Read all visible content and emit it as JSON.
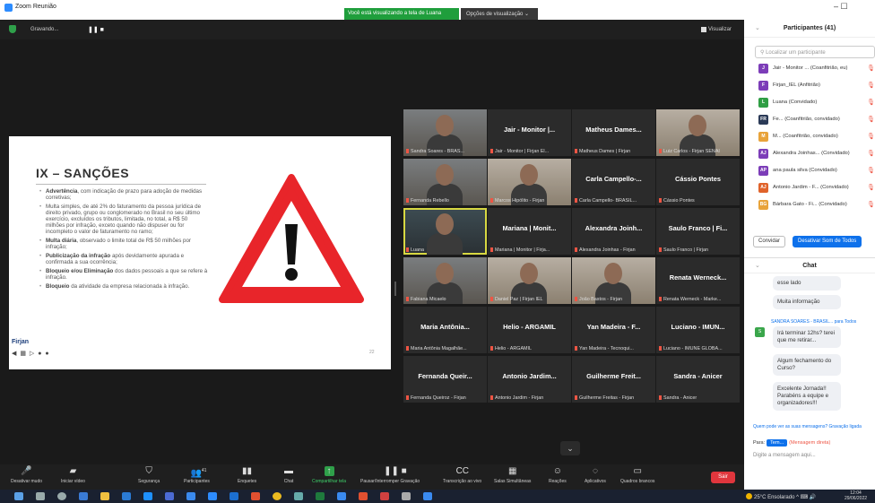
{
  "window": {
    "title": "Zoom Reunião",
    "controls": "– ☐"
  },
  "banner": {
    "sharing": "Você está visualizando a tela de Luana",
    "view_options": "Opções de visualização ⌄"
  },
  "meeting": {
    "status": "Gravando...",
    "pause": "❚❚ ■",
    "view_label": "Visualizar"
  },
  "slide": {
    "title": "IX – SANÇÕES",
    "items": [
      {
        "key": "Advertência",
        "text": ", com indicação de prazo para adoção de medidas corretivas;"
      },
      {
        "key": "",
        "text": "Multa simples, de até 2% do faturamento da pessoa jurídica de direito privado, grupo ou conglomerado no Brasil no seu último exercício, excluídos os tributos, limitada, no total, a R$ 50 milhões por infração, exceto quando não dispuser ou for incompleto o valor de faturamento no ramo;"
      },
      {
        "key": "Multa diária",
        "text": ", observado o limite total de R$ 50 milhões por infração;"
      },
      {
        "key": "Publicização da infração",
        "text": " após devidamente apurada e confirmada a sua ocorrência;"
      },
      {
        "key": "Bloqueio e/ou Eliminação",
        "text": " dos dados pessoais a que se refere à infração."
      },
      {
        "key": "Bloqueio",
        "text": " da atividade da empresa relacionada à infração."
      }
    ],
    "logo": "Firjan",
    "controls": "◀ ▦ ▷ ● ●",
    "page": "22"
  },
  "tiles": [
    {
      "name": "",
      "caption": "Sandra Soares - BRAS...",
      "style": "photo"
    },
    {
      "name": "Jair - Monitor |...",
      "caption": "Jair - Monitor | Firjan El...",
      "style": ""
    },
    {
      "name": "Matheus Dames...",
      "caption": "Matheus Dames | Firjan",
      "style": ""
    },
    {
      "name": "",
      "caption": "Luiz Carlos - Firjan SENAI",
      "style": "photo l"
    },
    {
      "name": "",
      "caption": "Fernanda Rebello",
      "style": "photo"
    },
    {
      "name": "",
      "caption": "Marcos Hipólito - Firjan",
      "style": "photo l"
    },
    {
      "name": "Carla Campello-...",
      "caption": "Carla Campello- BRASIL...",
      "style": ""
    },
    {
      "name": "Cássio Pontes",
      "caption": "Cássio Pontes",
      "style": ""
    },
    {
      "name": "",
      "caption": "Luana",
      "style": "photo d active"
    },
    {
      "name": "Mariana | Monit...",
      "caption": "Mariana | Monitor | Firja...",
      "style": ""
    },
    {
      "name": "Alexandra Joinh...",
      "caption": "Alexandra Joinhas - Firjan",
      "style": ""
    },
    {
      "name": "Saulo Franco | Fi...",
      "caption": "Saulo Franco | Firjan",
      "style": ""
    },
    {
      "name": "",
      "caption": "Fabiana Micaelo",
      "style": "photo"
    },
    {
      "name": "",
      "caption": "Daniel Paz | Firjan IEL",
      "style": "photo l"
    },
    {
      "name": "",
      "caption": "João Bastos - Firjan",
      "style": "photo l"
    },
    {
      "name": "Renata Werneck...",
      "caption": "Renata Werneck - Marke...",
      "style": ""
    },
    {
      "name": "Maria Antônia...",
      "caption": "Maria Antônia Magalhãe...",
      "style": ""
    },
    {
      "name": "Helio - ARGAMIL",
      "caption": "Helio - ARGAMIL",
      "style": ""
    },
    {
      "name": "Yan Madeira - F...",
      "caption": "Yan Madeira - Tecnoqui...",
      "style": ""
    },
    {
      "name": "Luciano - IMUN...",
      "caption": "Luciano - IMUNE GLOBA...",
      "style": ""
    },
    {
      "name": "Fernanda Queir...",
      "caption": "Fernanda Queiroz - Firjan",
      "style": ""
    },
    {
      "name": "Antonio Jardim...",
      "caption": "Antonio Jardim - Firjan",
      "style": ""
    },
    {
      "name": "Guilherme Freit...",
      "caption": "Guilherme Freitas - Firjan",
      "style": ""
    },
    {
      "name": "Sandra - Anicer",
      "caption": "Sandra - Anicer",
      "style": ""
    }
  ],
  "grid_more": "⌄",
  "toolbar": {
    "items": [
      {
        "label": "Desativar mudo",
        "icon": "🎤"
      },
      {
        "label": "Iniciar vídeo",
        "icon": "▰"
      },
      {
        "label": "Segurança",
        "icon": "⛉"
      },
      {
        "label": "Participantes",
        "icon": "👥",
        "badge": "41"
      },
      {
        "label": "Enquetes",
        "icon": "▮▮"
      },
      {
        "label": "Chat",
        "icon": "▬"
      },
      {
        "label": "Compartilhar tela",
        "icon": "↑"
      },
      {
        "label": "Pausar/Interromper Gravação",
        "icon": "❚❚ ■"
      },
      {
        "label": "Transcrição ao vivo",
        "icon": "CC"
      },
      {
        "label": "Salas Simultâneas",
        "icon": "▦"
      },
      {
        "label": "Reações",
        "icon": "☺"
      },
      {
        "label": "Aplicativos",
        "icon": "◌"
      },
      {
        "label": "Quadros brancos",
        "icon": "▭"
      }
    ],
    "leave": "Sair"
  },
  "panel": {
    "title": "Participantes (41)",
    "search_placeholder": "Localizar um participante",
    "participants": [
      {
        "init": "J",
        "color": "#7c3db8",
        "name": "Jair - Monitor ... (Coanfitrião, eu)"
      },
      {
        "init": "F",
        "color": "#7c3db8",
        "name": "Firjan_IEL (Anfitrião)"
      },
      {
        "init": "L",
        "color": "#2f9e44",
        "name": "Luana (Convidado)"
      },
      {
        "init": "FR",
        "color": "#2b3a57",
        "name": "Fe... (Coanfitrião, convidado)"
      },
      {
        "init": "M",
        "color": "#e8a33a",
        "name": "M... (Coanfitrião, convidado)"
      },
      {
        "init": "AJ",
        "color": "#7c3db8",
        "name": "Alexandra Joinhas... (Convidado)"
      },
      {
        "init": "AP",
        "color": "#7c3db8",
        "name": "ana paula silva (Convidado)"
      },
      {
        "init": "AJ",
        "color": "#e0632b",
        "name": "Antonio Jardim - F... (Convidado)"
      },
      {
        "init": "BG",
        "color": "#e8a33a",
        "name": "Bárbara Gato - Fi... (Convidado)"
      }
    ],
    "invite": "Convidar",
    "mute_all": "Desativar Som de Todos"
  },
  "chat": {
    "title": "Chat",
    "m1": "esse lado",
    "m2": "Muita informação",
    "sender": "SANDRA SOARES - BRASIL...   para Todos",
    "sender_init": "S",
    "m3": "Irá terminar 12hs? terei que me retirar...",
    "m4": "Algum fechamento do Curso?",
    "m5": "Excelente Jornada!! Parabéns a equipe e organizadores!!!",
    "who_can_see": "Quem pode ver as suas mensagens? Gravação ligada",
    "to_label": "Para:",
    "to_select": "Tem...",
    "dm_note": "(Mensagem direta)",
    "input_placeholder": "Digite a mensagem aqui..."
  },
  "taskbar": {
    "tray": "25°C  Ensolarado  ^  ⌨  🔊",
    "time": "12:04",
    "date": "29/06/2022"
  },
  "colors": {
    "share_green": "#1f9e3c",
    "leave_red": "#e0363d",
    "accent_blue": "#0e71eb"
  }
}
